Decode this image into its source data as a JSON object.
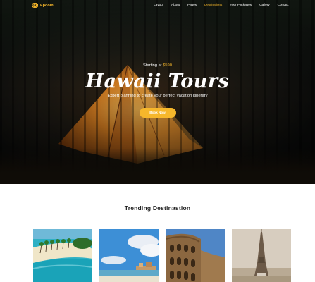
{
  "brand": {
    "name": "Epoom",
    "accent": "#f6b72b"
  },
  "nav": {
    "links": [
      "Layout",
      "About",
      "Pages",
      "Destinations",
      "Your Packages",
      "Gallery",
      "Contact"
    ],
    "active_index": 3
  },
  "hero": {
    "starting_label": "Starting at",
    "price": "$590",
    "title": "Hawaii Tours",
    "subtitle": "Expert planning to create your perfect vacation itinerary",
    "button_label": "Book Now"
  },
  "trending": {
    "title": "Trending Destinastion",
    "cards": [
      {
        "icon": "tropical-beach-photo"
      },
      {
        "icon": "coastal-city-photo"
      },
      {
        "icon": "colosseum-photo"
      },
      {
        "icon": "eiffel-tower-photo"
      }
    ]
  }
}
